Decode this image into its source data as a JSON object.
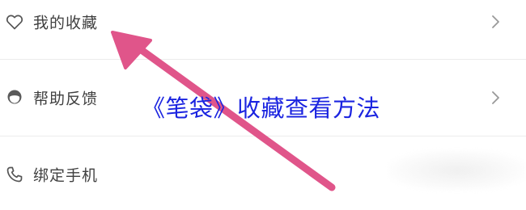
{
  "menu": {
    "items": [
      {
        "label": "我的收藏",
        "icon": "heart-icon",
        "has_chevron": true
      },
      {
        "label": "帮助反馈",
        "icon": "support-agent-icon",
        "has_chevron": true
      },
      {
        "label": "绑定手机",
        "icon": "phone-icon",
        "has_chevron": false
      }
    ]
  },
  "overlay": {
    "caption": "《笔袋》收藏查看方法",
    "caption_color": "#1b24e0",
    "arrow_color": "#e0558a",
    "arrow_icon": "pointer-arrow-icon"
  },
  "colors": {
    "label_text": "#404040",
    "icon_stroke": "#555555",
    "chevron": "#999999",
    "divider": "#ececec"
  }
}
